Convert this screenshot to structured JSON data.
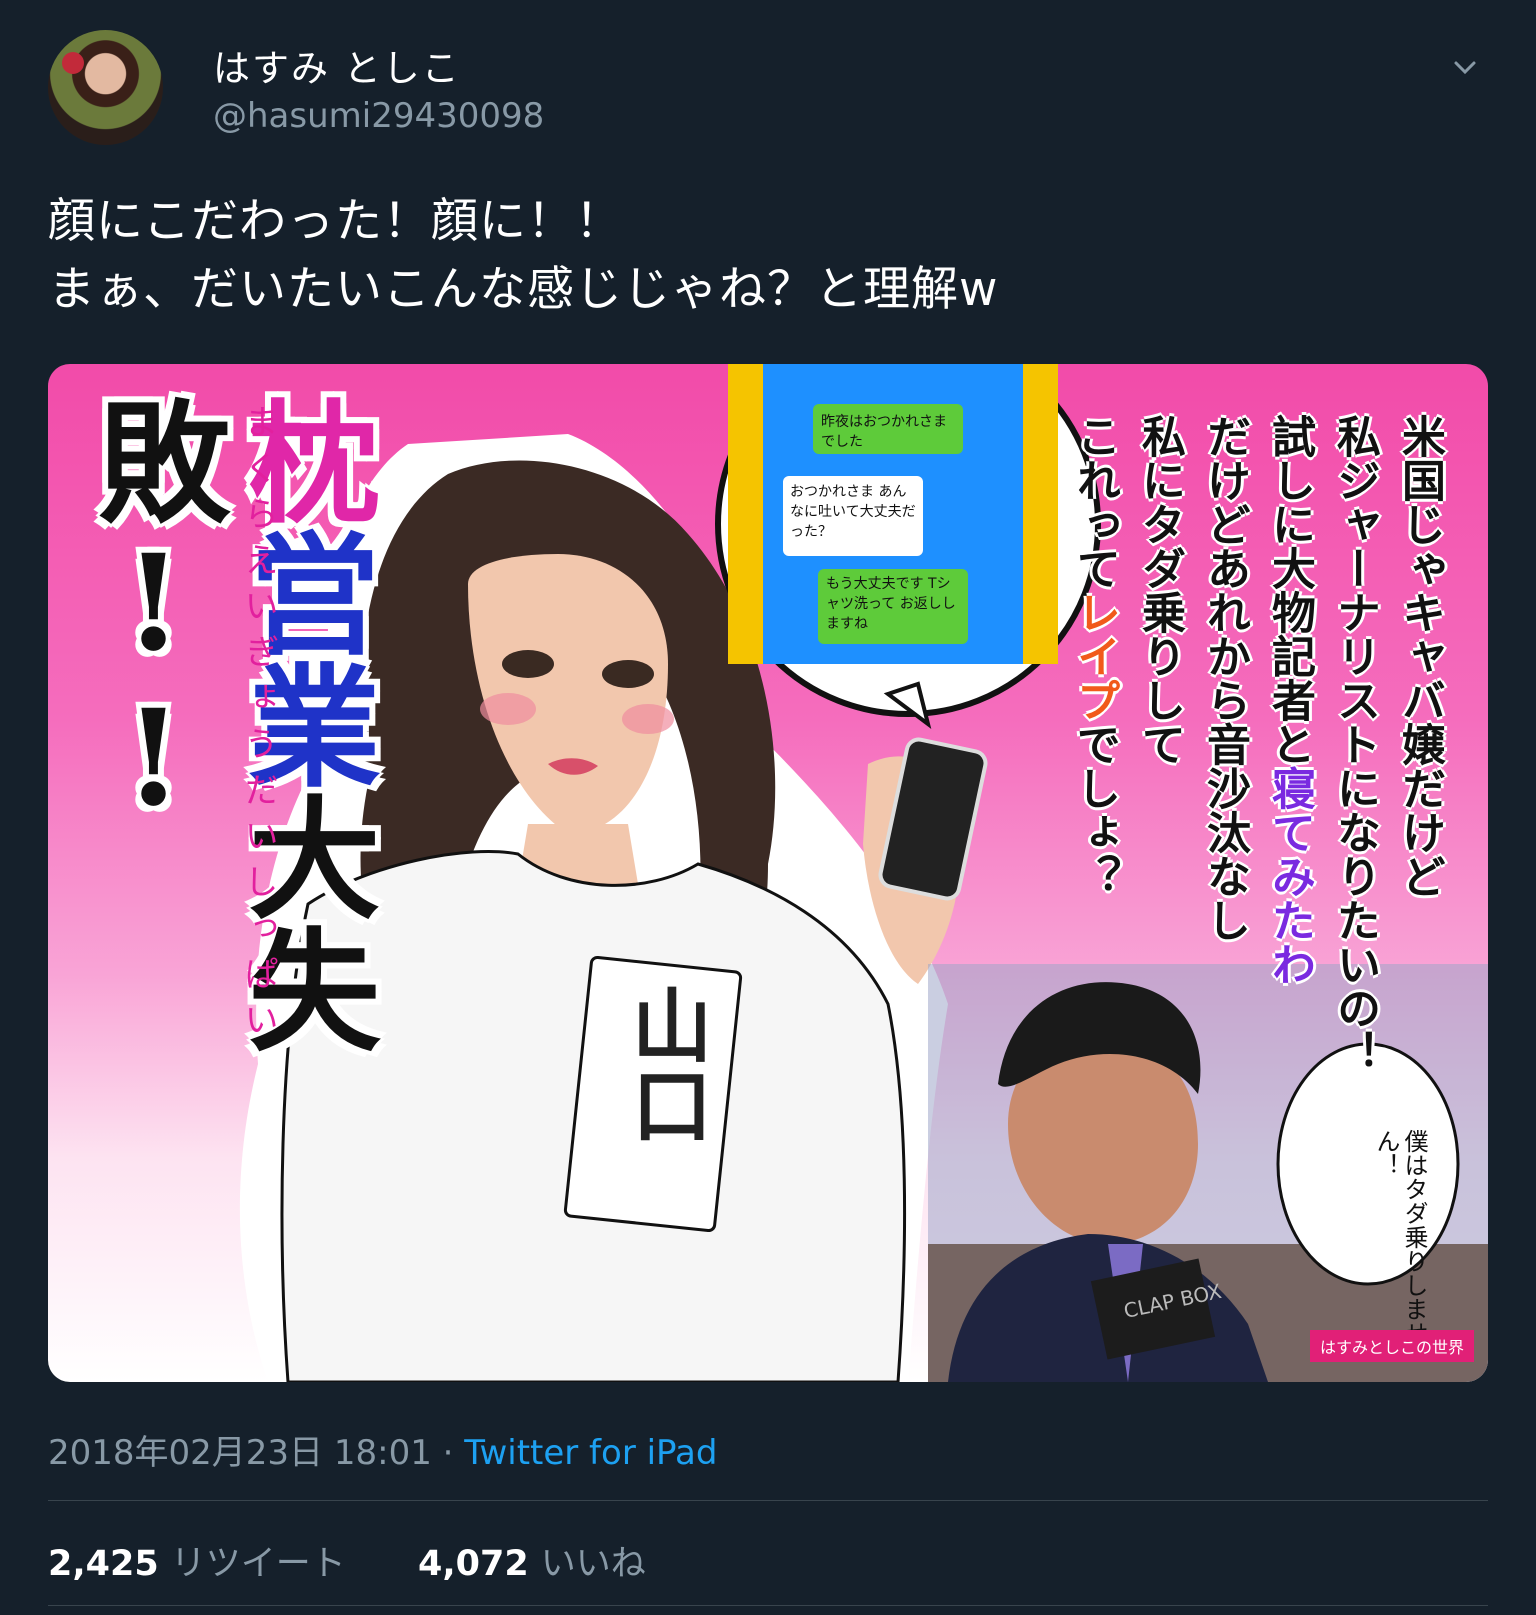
{
  "user": {
    "display_name": "はすみ としこ",
    "handle": "@hasumi29430098"
  },
  "tweet": {
    "lines": [
      "顔にこだわった！顔に！！",
      "まぁ、だいたいこんな感じじゃね？と理解w"
    ]
  },
  "media": {
    "title_part1": "枕",
    "title_part2": "営業",
    "title_part3": "大失敗!!",
    "title_ruby": "まくらえいぎょうだいしっぱい",
    "right_col1": "米国じゃキャバ嬢だけど",
    "right_col2": "私ジャーナリストになりたいの！",
    "right_col3a": "試しに大物記者と",
    "right_col3b": "寝てみたわ",
    "right_col4": "だけどあれから音沙汰なし",
    "right_col5": "私にタダ乗りして",
    "right_col6a": "これって",
    "right_col6b": "レイプ",
    "right_col6c": "でしょ？",
    "chat_1": "昨夜はおつかれさまでした",
    "chat_2": "おつかれさま あんなに吐いて大丈夫だった？",
    "chat_3": "もう大丈夫です Tシャツ洗って お返ししますね",
    "shirt_text": "山口",
    "man_speech": "僕はタダ乗りしません！",
    "box_text": "CLAP BOX",
    "credit": "はすみとしこの世界"
  },
  "meta": {
    "timestamp": "2018年02月23日 18:01",
    "separator": " · ",
    "source": "Twitter for iPad"
  },
  "stats": {
    "retweets_count": "2,425",
    "retweets_label": "リツイート",
    "likes_count": "4,072",
    "likes_label": "いいね"
  }
}
